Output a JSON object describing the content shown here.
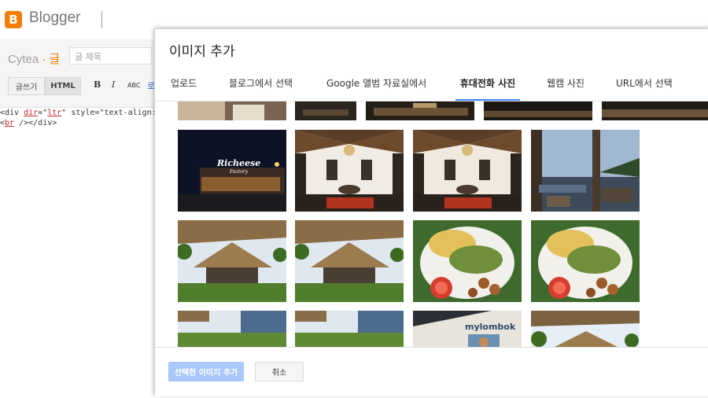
{
  "app": {
    "logo_letter": "B",
    "name": "Blogger"
  },
  "editor": {
    "blog_name": "Cytea",
    "blog_sep": "·",
    "blog_section": "글",
    "title_placeholder": "글 제목",
    "mode_compose": "글쓰기",
    "mode_html": "HTML",
    "toolbar": {
      "bold": "B",
      "italic": "I",
      "strike": "ABC",
      "link": "로"
    },
    "code_lines": [
      [
        "<div ",
        "dir",
        "=\"",
        "ltr",
        "\" style=\"text-align: l"
      ],
      [
        "<",
        "br",
        " /></div>"
      ]
    ]
  },
  "dialog": {
    "title": "이미지 추가",
    "tabs": [
      {
        "label": "업로드",
        "active": false
      },
      {
        "label": "블로그에서 선택",
        "active": false
      },
      {
        "label": "Google 앨범 자료실에서",
        "active": false
      },
      {
        "label": "휴대전화 사진",
        "active": true
      },
      {
        "label": "웹캠 사진",
        "active": false
      },
      {
        "label": "URL에서 선택",
        "active": false
      }
    ],
    "thumb_text": {
      "richeese": "Richeese",
      "factory": "Factory",
      "magazine": "mylombok"
    },
    "add_button": "선택한 이미지 추가",
    "cancel_button": "취소"
  },
  "colors": {
    "blogger_orange": "#f57d00",
    "tab_underline": "#4285f4",
    "add_button_disabled": "#a8c7fa"
  }
}
